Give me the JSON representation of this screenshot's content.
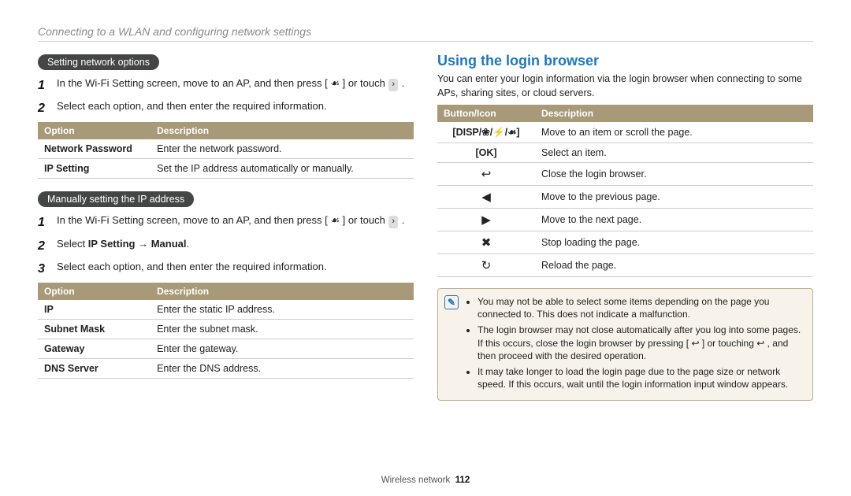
{
  "breadcrumb": "Connecting to a WLAN and configuring network settings",
  "left": {
    "pill1": "Setting network options",
    "step1_1": "In the Wi-Fi Setting screen, move to an AP, and then press ",
    "step1_1b": " or touch ",
    "step1_2": "Select each option, and then enter the required information.",
    "table1": {
      "headers": [
        "Option",
        "Description"
      ],
      "rows": [
        [
          "Network Password",
          "Enter the network password."
        ],
        [
          "IP Setting",
          "Set the IP address automatically or manually."
        ]
      ]
    },
    "pill2": "Manually setting the IP address",
    "step2_1": "In the Wi-Fi Setting screen, move to an AP, and then press ",
    "step2_1b": " or touch ",
    "step2_2a": "Select ",
    "step2_2b": "IP Setting",
    "step2_2c": " → ",
    "step2_2d": "Manual",
    "step2_3": "Select each option, and then enter the required information.",
    "table2": {
      "headers": [
        "Option",
        "Description"
      ],
      "rows": [
        [
          "IP",
          "Enter the static IP address."
        ],
        [
          "Subnet Mask",
          "Enter the subnet mask."
        ],
        [
          "Gateway",
          "Enter the gateway."
        ],
        [
          "DNS Server",
          "Enter the DNS address."
        ]
      ]
    }
  },
  "right": {
    "heading": "Using the login browser",
    "intro": "You can enter your login information via the login browser when connecting to some APs, sharing sites, or cloud servers.",
    "table": {
      "headers": [
        "Button/Icon",
        "Description"
      ],
      "rows": [
        {
          "icon": "[DISP/❀/⚡/☙]",
          "desc": "Move to an item or scroll the page."
        },
        {
          "icon": "[OK]",
          "desc": "Select an item."
        },
        {
          "icon": "↩",
          "desc": "Close the login browser."
        },
        {
          "icon": "◀",
          "desc": "Move to the previous page."
        },
        {
          "icon": "▶",
          "desc": "Move to the next page."
        },
        {
          "icon": "✖",
          "desc": "Stop loading the page."
        },
        {
          "icon": "↻",
          "desc": "Reload the page."
        }
      ]
    },
    "notes": [
      "You may not be able to select some items depending on the page you connected to. This does not indicate a malfunction.",
      "The login browser may not close automatically after you log into some pages. If this occurs, close the login browser by pressing [ ↩ ] or touching ↩ , and then proceed with the desired operation.",
      "It may take longer to load the login page due to the page size or network speed. If this occurs, wait until the login information input window appears."
    ]
  },
  "footer": {
    "section": "Wireless network",
    "page": "112"
  },
  "icons": {
    "flower_bracket": "[ ☙ ]",
    "chevron_chip": "›"
  }
}
